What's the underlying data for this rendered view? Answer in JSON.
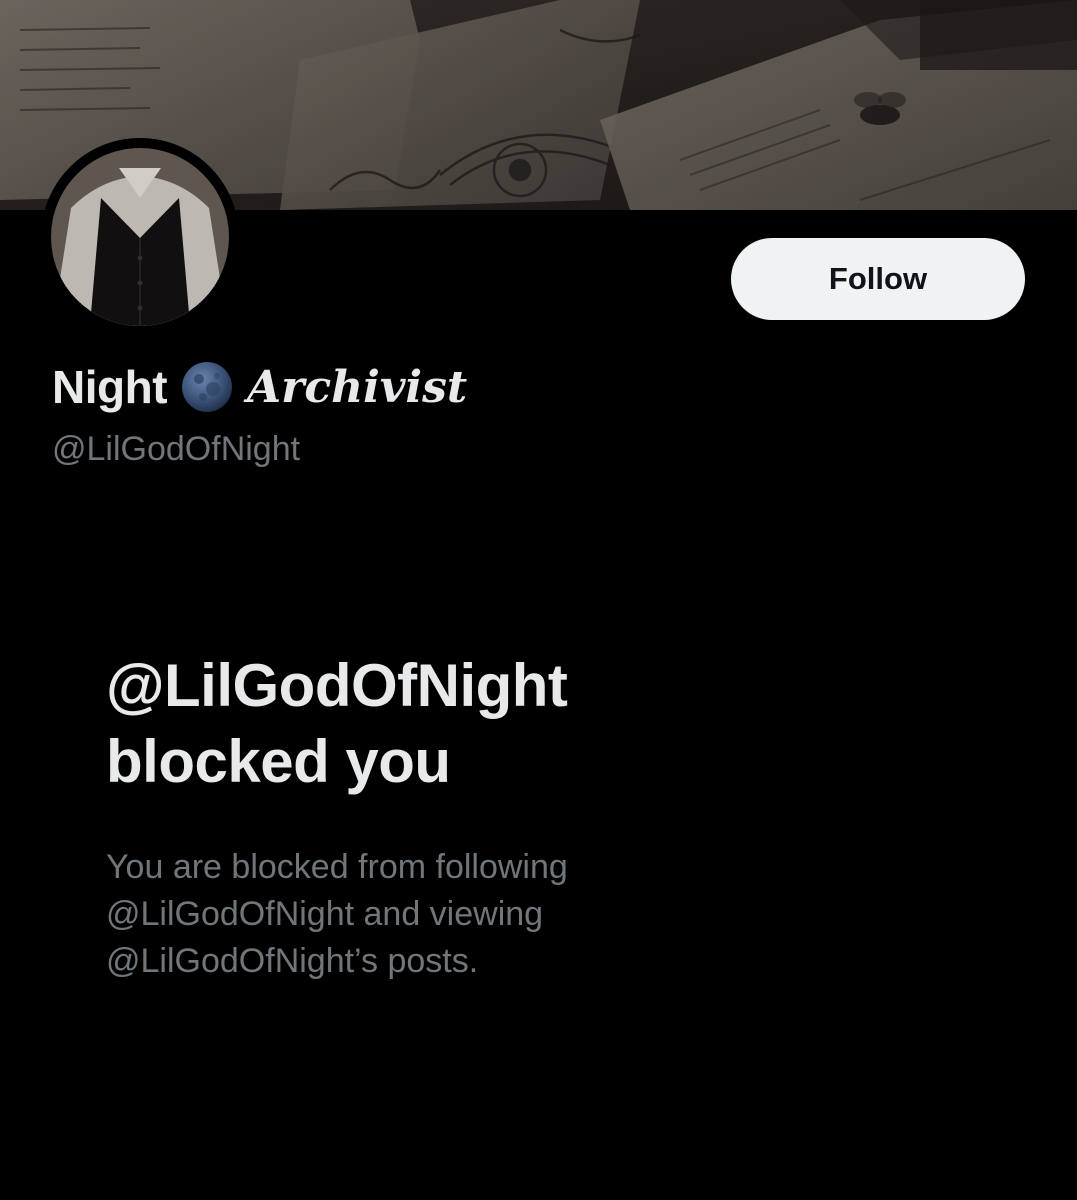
{
  "profile": {
    "display_name_prefix": "Night",
    "display_name_suffix": "Archivist",
    "handle": "@LilGodOfNight",
    "follow_label": "Follow"
  },
  "icons": {
    "banner": "collage-image",
    "avatar": "profile-photo",
    "name_emoji": "moon-icon"
  },
  "blocked": {
    "title_line1": "@LilGodOfNight",
    "title_line2": "blocked you",
    "desc_line1": "You are blocked from following",
    "desc_line2": "@LilGodOfNight and viewing",
    "desc_line3": "@LilGodOfNight’s posts."
  },
  "colors": {
    "background": "#000000",
    "primary_text": "#e7e9ea",
    "secondary_text": "#71767b",
    "button_bg": "#eff3f4",
    "button_text": "#0f1419"
  }
}
